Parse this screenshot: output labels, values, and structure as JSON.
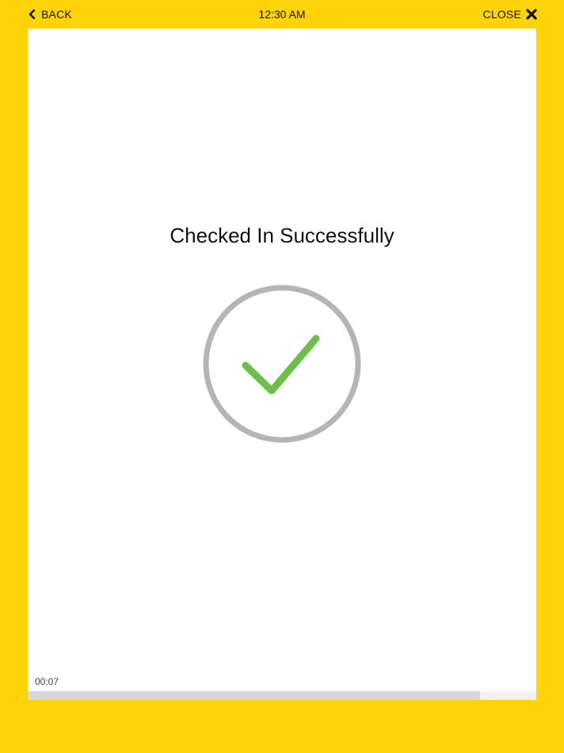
{
  "header": {
    "back_label": "BACK",
    "time": "12:30 AM",
    "close_label": "CLOSE"
  },
  "main": {
    "title": "Checked In Successfully",
    "status_icon": "checkmark-circle-icon"
  },
  "footer": {
    "timer": "00:07",
    "progress": 0.889
  },
  "colors": {
    "background": "#FFD30A",
    "card": "#FFFFFF",
    "circle": "#B5B5B5",
    "check": "#6CC04A",
    "progress_fill": "#D7D7DB",
    "progress_track": "#F2F2F2"
  }
}
